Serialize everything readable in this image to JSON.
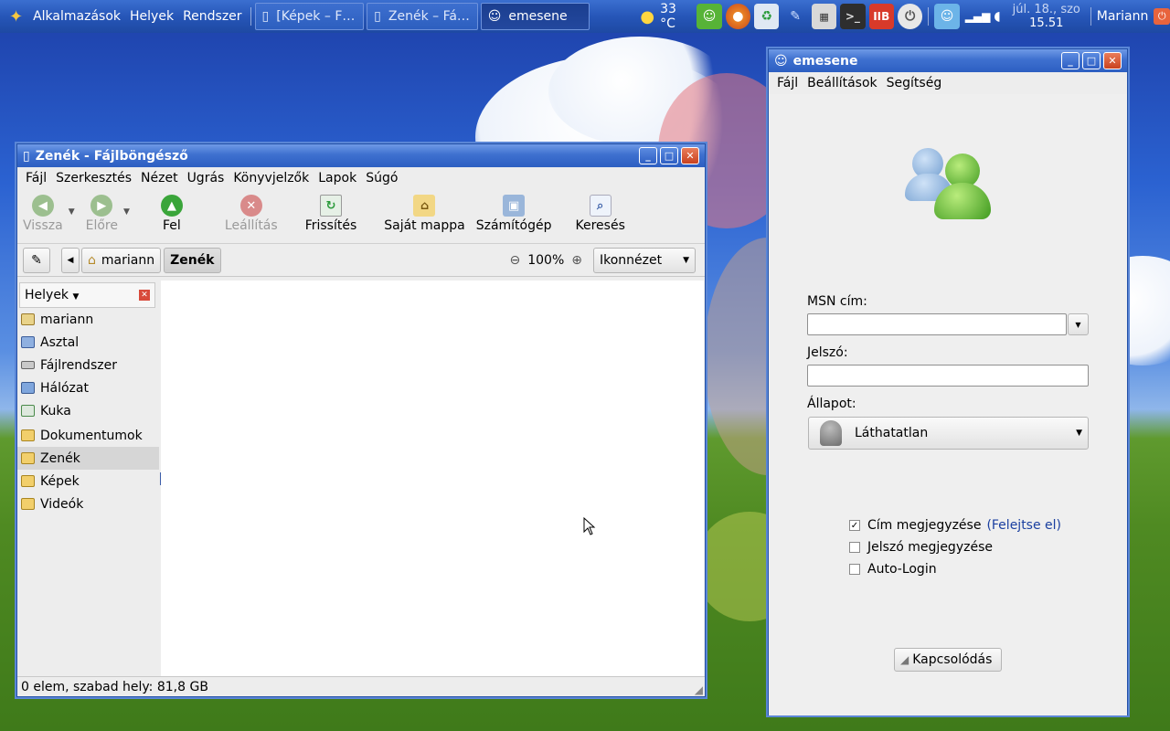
{
  "panel": {
    "menus": [
      "Alkalmazások",
      "Helyek",
      "Rendszer"
    ],
    "tasks": [
      {
        "label": "[Képek – F…",
        "active": false
      },
      {
        "label": "Zenék – Fá…",
        "active": false
      },
      {
        "label": "emesene",
        "active": true
      }
    ],
    "weather": "33 °C",
    "date": "júl. 18., szo",
    "time": "15.51",
    "user": "Mariann"
  },
  "filebrowser": {
    "title": "Zenék - Fájlböngésző",
    "menu": [
      "Fájl",
      "Szerkesztés",
      "Nézet",
      "Ugrás",
      "Könyvjelzők",
      "Lapok",
      "Súgó"
    ],
    "toolbar": {
      "back": "Vissza",
      "forward": "Előre",
      "up": "Fel",
      "stop": "Leállítás",
      "reload": "Frissítés",
      "home": "Saját mappa",
      "computer": "Számítógép",
      "search": "Keresés"
    },
    "path": [
      "mariann",
      "Zenék"
    ],
    "zoom": "100%",
    "view_mode": "Ikonnézet",
    "sidebar": {
      "title": "Helyek",
      "items": [
        {
          "label": "mariann",
          "icon": "home-icon"
        },
        {
          "label": "Asztal",
          "icon": "desktop-icon"
        },
        {
          "label": "Fájlrendszer",
          "icon": "drive-icon"
        },
        {
          "label": "Hálózat",
          "icon": "network-icon"
        },
        {
          "label": "Kuka",
          "icon": "trash-icon"
        },
        {
          "label": "Dokumentumok",
          "icon": "folder-icon"
        },
        {
          "label": "Zenék",
          "icon": "folder-icon",
          "selected": true
        },
        {
          "label": "Képek",
          "icon": "folder-icon"
        },
        {
          "label": "Videók",
          "icon": "folder-icon"
        }
      ]
    },
    "status": "0 elem, szabad hely: 81,8 GB"
  },
  "emesene": {
    "title": "emesene",
    "menu": [
      "Fájl",
      "Beállítások",
      "Segítség"
    ],
    "msn_label": "MSN cím:",
    "msn_value": "",
    "password_label": "Jelszó:",
    "password_value": "",
    "status_label": "Állapot:",
    "status_value": "Láthatatlan",
    "remember_address": "Cím megjegyzése",
    "forget_link": "(Felejtse el)",
    "remember_password": "Jelszó megjegyzése",
    "auto_login": "Auto-Login",
    "connect": "Kapcsolódás",
    "remember_address_checked": true,
    "remember_password_checked": false,
    "auto_login_checked": false
  },
  "colors": {
    "panel": "#2656b8",
    "titlebar": "#3e70cf",
    "link": "#1a3fa0"
  }
}
